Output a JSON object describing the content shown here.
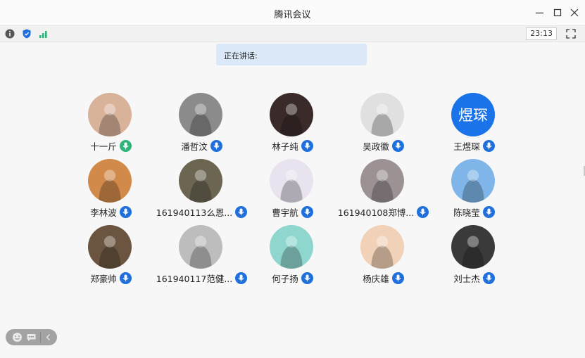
{
  "window": {
    "title": "腾讯会议"
  },
  "toolbar": {
    "timer": "23:13"
  },
  "speaking": {
    "label": "正在讲话:"
  },
  "colors": {
    "accent": "#1f6fdc",
    "mic_active": "#2fb57a",
    "panel": "#dbe8f7"
  },
  "participants": [
    {
      "name": "十一斤",
      "mic": "active",
      "avatar_icon": "photo-girl-icon",
      "bg": "#d9b29a"
    },
    {
      "name": "潘哲汶",
      "mic": "muted",
      "avatar_icon": "photo-street-icon",
      "bg": "#8b8b8b"
    },
    {
      "name": "林子纯",
      "mic": "muted",
      "avatar_icon": "photo-woman-icon",
      "bg": "#3a2a2a"
    },
    {
      "name": "吴政徽",
      "mic": "muted",
      "avatar_icon": "photo-anime-sketch-icon",
      "bg": "#e0e0e0"
    },
    {
      "name": "王煜琛",
      "mic": "muted",
      "avatar_text": "煜琛",
      "bg": "#1a73e8"
    },
    {
      "name": "李林波",
      "mic": "muted",
      "avatar_icon": "photo-sunset-icon",
      "bg": "#d28a4a"
    },
    {
      "name": "161940113么恩...",
      "mic": "muted",
      "avatar_icon": "photo-knight-icon",
      "bg": "#6b6552"
    },
    {
      "name": "曹宇航",
      "mic": "muted",
      "avatar_icon": "photo-anime-boy-icon",
      "bg": "#e8e3ef"
    },
    {
      "name": "161940108郑博...",
      "mic": "muted",
      "avatar_icon": "photo-man-icon",
      "bg": "#9c9294"
    },
    {
      "name": "陈晓莹",
      "mic": "muted",
      "avatar_icon": "photo-girl-smile-icon",
      "bg": "#7fb5e8"
    },
    {
      "name": "郑豪帅",
      "mic": "muted",
      "avatar_icon": "photo-feather-icon",
      "bg": "#6b5540"
    },
    {
      "name": "161940117范健...",
      "mic": "muted",
      "avatar_icon": "photo-astronaut-icon",
      "bg": "#bdbdbd"
    },
    {
      "name": "何子扬",
      "mic": "muted",
      "avatar_icon": "photo-anime-girl-icon",
      "bg": "#8fd6cf"
    },
    {
      "name": "杨庆雄",
      "mic": "muted",
      "avatar_icon": "photo-anime-boy2-icon",
      "bg": "#f1d2b8"
    },
    {
      "name": "刘士杰",
      "mic": "muted",
      "avatar_icon": "photo-man2-icon",
      "bg": "#3a3a3a"
    }
  ]
}
